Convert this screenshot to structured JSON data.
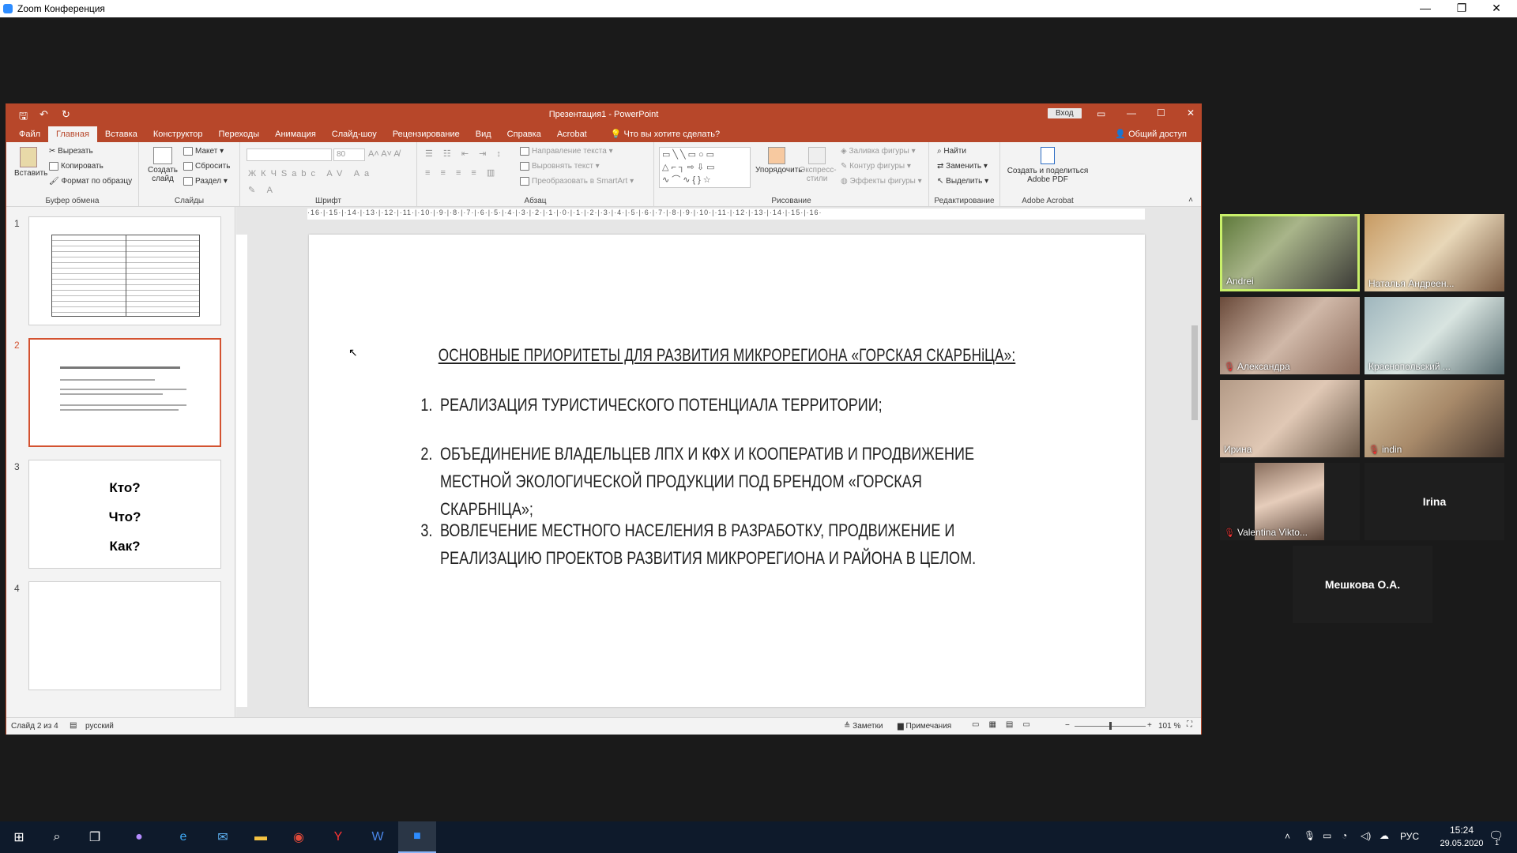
{
  "zoom": {
    "title": "Zoom Конференция",
    "window_controls": [
      "—",
      "❐",
      "✕"
    ]
  },
  "ppt": {
    "title": "Презентация1 - PowerPoint",
    "signin": "Вход",
    "tabs": [
      "Файл",
      "Главная",
      "Вставка",
      "Конструктор",
      "Переходы",
      "Анимация",
      "Слайд-шоу",
      "Рецензирование",
      "Вид",
      "Справка",
      "Acrobat"
    ],
    "active_tab": "Главная",
    "tell_me": "Что вы хотите сделать?",
    "share": "Общий доступ",
    "ribbon": {
      "clipboard": {
        "paste": "Вставить",
        "cut": "Вырезать",
        "copy": "Копировать",
        "format_painter": "Формат по образцу",
        "label": "Буфер обмена"
      },
      "slides": {
        "new": "Создать слайд",
        "layout": "Макет",
        "reset": "Сбросить",
        "section": "Раздел",
        "label": "Слайды"
      },
      "font": {
        "size": "80",
        "label": "Шрифт"
      },
      "paragraph": {
        "text_dir": "Направление текста",
        "align_text": "Выровнять текст",
        "smartart": "Преобразовать в SmartArt",
        "label": "Абзац"
      },
      "drawing": {
        "arrange": "Упорядочить",
        "quick_styles": "Экспресс-стили",
        "fill": "Заливка фигуры",
        "outline": "Контур фигуры",
        "effects": "Эффекты фигуры",
        "label": "Рисование"
      },
      "editing": {
        "find": "Найти",
        "replace": "Заменить",
        "select": "Выделить",
        "label": "Редактирование"
      },
      "acrobat": {
        "create_share": "Создать и поделиться Adobe PDF",
        "label": "Adobe Acrobat"
      }
    },
    "ruler": "·16·|·15·|·14·|·13·|·12·|·11·|·10·|·9·|·8·|·7·|·6·|·5·|·4·|·3·|·2·|·1·|·0·|·1·|·2·|·3·|·4·|·5·|·6·|·7·|·8·|·9·|·10·|·11·|·12·|·13·|·14·|·15·|·16·",
    "thumbnails": [
      {
        "num": "1"
      },
      {
        "num": "2"
      },
      {
        "num": "3",
        "lines": [
          "Кто?",
          "Что?",
          "Как?"
        ]
      },
      {
        "num": "4"
      }
    ],
    "slide": {
      "title": "ОСНОВНЫЕ ПРИОРИТЕТЫ ДЛЯ РАЗВИТИЯ МИКРОРЕГИОНА «ГОРСКАЯ СКАРБНіЦА»:",
      "items": [
        {
          "n": "1.",
          "text": "РЕАЛИЗАЦИЯ ТУРИСТИЧЕСКОГО ПОТЕНЦИАЛА ТЕРРИТОРИИ;"
        },
        {
          "n": "2.",
          "text": "ОБЪЕДИНЕНИЕ ВЛАДЕЛЬЦЕВ ЛПХ И КФХ И КООПЕРАТИВ И ПРОДВИЖЕНИЕ МЕСТНОЙ ЭКОЛОГИЧЕСКОЙ ПРОДУКЦИИ ПОД БРЕНДОМ «ГОРСКАЯ СКАРБНІЦА»;"
        },
        {
          "n": "3.",
          "text": "ВОВЛЕЧЕНИЕ МЕСТНОГО НАСЕЛЕНИЯ В РАЗРАБОТКУ, ПРОДВИЖЕНИЕ И РЕАЛИЗАЦИЮ ПРОЕКТОВ РАЗВИТИЯ МИКРОРЕГИОНА И РАЙОНА В ЦЕЛОМ."
        }
      ]
    },
    "status": {
      "slide": "Слайд 2 из 4",
      "lang": "русский",
      "notes": "Заметки",
      "comments": "Примечания",
      "zoom": "101 %"
    }
  },
  "participants": [
    {
      "name": "Andrei",
      "muted": false,
      "active": true,
      "bg": "#6b7b4a"
    },
    {
      "name": "Наталья Андреен...",
      "muted": false,
      "active": false,
      "bg": "#b58a5a"
    },
    {
      "name": "Александра",
      "muted": true,
      "active": false,
      "bg": "#8a6a5a"
    },
    {
      "name": "Краснопольский ...",
      "muted": false,
      "active": false,
      "bg": "#8aa0a8"
    },
    {
      "name": "Ирина",
      "muted": false,
      "active": false,
      "bg": "#a08a78"
    },
    {
      "name": "indin",
      "muted": true,
      "active": false,
      "bg": "#b8a080"
    },
    {
      "name": "Valentina Vikto...",
      "muted": true,
      "active": false,
      "bg": "#7a6a60"
    },
    {
      "name": "Irina",
      "muted": false,
      "active": false,
      "bg": ""
    },
    {
      "name": "Мешкова О.А.",
      "muted": false,
      "active": false,
      "bg": ""
    }
  ],
  "taskbar": {
    "lang": "РУС",
    "time": "15:24",
    "date": "29.05.2020",
    "notif_count": "1"
  },
  "colors": {
    "ppt_accent": "#b7472a",
    "active_speaker": "#c9f06a",
    "taskbar": "#0e1a2b"
  }
}
